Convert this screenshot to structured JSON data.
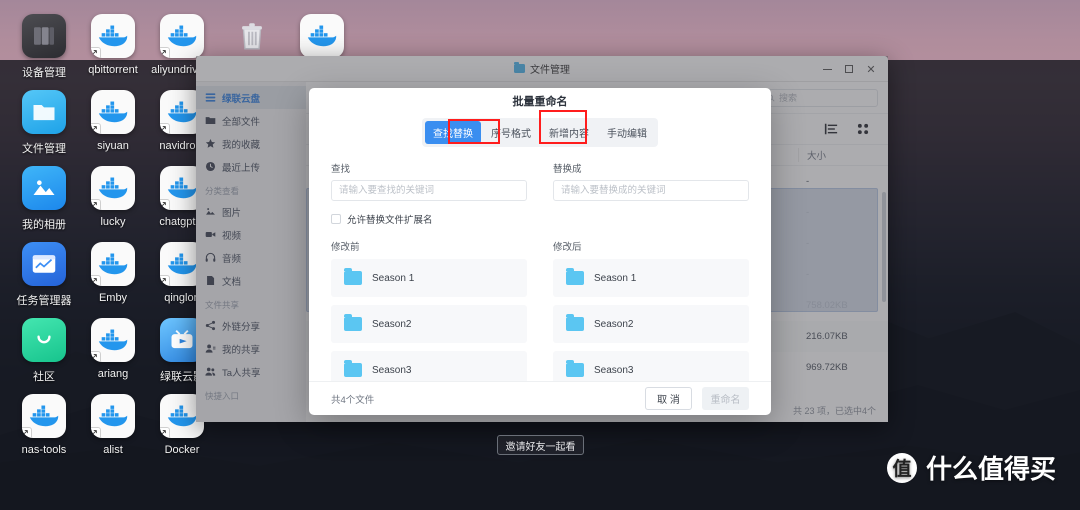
{
  "desktop": {
    "icons": [
      {
        "label": "设备管理",
        "icon": "device-manager-icon",
        "type": "device"
      },
      {
        "label": "qbittorrent",
        "icon": "docker-icon",
        "type": "docker"
      },
      {
        "label": "aliyundrive-s",
        "icon": "docker-icon",
        "type": "docker"
      },
      {
        "label": "文件管理",
        "icon": "file-manager-icon",
        "type": "files"
      },
      {
        "label": "siyuan",
        "icon": "docker-icon",
        "type": "docker"
      },
      {
        "label": "navidrom",
        "icon": "docker-icon",
        "type": "docker"
      },
      {
        "label": "我的相册",
        "icon": "photo-album-icon",
        "type": "album"
      },
      {
        "label": "lucky",
        "icon": "docker-icon",
        "type": "docker"
      },
      {
        "label": "chatgpt-v",
        "icon": "docker-icon",
        "type": "docker"
      },
      {
        "label": "任务管理器",
        "icon": "task-manager-icon",
        "type": "task"
      },
      {
        "label": "Emby",
        "icon": "docker-icon",
        "type": "docker"
      },
      {
        "label": "qinglon",
        "icon": "docker-icon",
        "type": "docker"
      },
      {
        "label": "社区",
        "icon": "community-icon",
        "type": "bbs"
      },
      {
        "label": "ariang",
        "icon": "docker-icon",
        "type": "docker"
      },
      {
        "label": "绿联云影",
        "icon": "tv-icon",
        "type": "tv"
      },
      {
        "label": "nas-tools",
        "icon": "docker-icon",
        "type": "docker"
      },
      {
        "label": "alist",
        "icon": "docker-icon",
        "type": "docker"
      },
      {
        "label": "Docker",
        "icon": "docker-icon",
        "type": "docker"
      }
    ],
    "trash_icon": "trash-icon",
    "top_docker_icon": "docker-icon",
    "invite_button": "邀请好友一起看",
    "watermark": {
      "mark": "值",
      "text": "什么值得买"
    }
  },
  "window": {
    "title": "文件管理",
    "title_icon": "blue-folder-icon",
    "controls": {
      "minimize": "–",
      "maximize": "□",
      "close": "✕"
    }
  },
  "sidebar": {
    "items": [
      {
        "label": "绿联云盘",
        "icon": "cloud-drive-icon",
        "active": true
      },
      {
        "label": "全部文件",
        "icon": "all-files-icon",
        "active": false
      },
      {
        "label": "我的收藏",
        "icon": "star-icon",
        "active": false
      },
      {
        "label": "最近上传",
        "icon": "clock-icon",
        "active": false
      }
    ],
    "section_category": "分类查看",
    "category_items": [
      {
        "label": "图片",
        "icon": "image-icon"
      },
      {
        "label": "视频",
        "icon": "video-icon"
      },
      {
        "label": "音频",
        "icon": "headphone-icon"
      },
      {
        "label": "文档",
        "icon": "document-icon"
      }
    ],
    "section_share": "文件共享",
    "share_items": [
      {
        "label": "外链分享",
        "icon": "share-icon"
      },
      {
        "label": "我的共享",
        "icon": "my-share-icon"
      },
      {
        "label": "Ta人共享",
        "icon": "others-share-icon"
      }
    ],
    "section_quick": "快捷入口"
  },
  "main": {
    "search_placeholder": "搜索",
    "search_icon": "search-icon",
    "view_list_icon": "list-view-icon",
    "view_grid_icon": "grid-view-icon",
    "size_column": "大小",
    "rows": [
      {
        "size": "-"
      },
      {
        "size": "-"
      },
      {
        "size": "-"
      },
      {
        "size": "-"
      },
      {
        "size": "758.02KB"
      },
      {
        "size": "216.07KB"
      },
      {
        "size": "969.72KB"
      }
    ],
    "status": "共 23 项，已选中4个"
  },
  "dialog": {
    "title": "批量重命名",
    "tabs": [
      {
        "label": "查找替换",
        "active": true,
        "annotated": true
      },
      {
        "label": "序号格式",
        "active": false,
        "annotated": false
      },
      {
        "label": "新增内容",
        "active": false,
        "annotated": true
      },
      {
        "label": "手动编辑",
        "active": false,
        "annotated": false
      }
    ],
    "find": {
      "label": "查找",
      "value": "",
      "placeholder": "请输入要查找的关键词"
    },
    "replace": {
      "label": "替换成",
      "value": "",
      "placeholder": "请输入要替换成的关键词"
    },
    "checkbox": {
      "label": "允许替换文件扩展名",
      "checked": false
    },
    "before_label": "修改前",
    "after_label": "修改后",
    "before_items": [
      "Season 1",
      "Season2",
      "Season3"
    ],
    "after_items": [
      "Season 1",
      "Season2",
      "Season3"
    ],
    "file_count": "共4个文件",
    "cancel_button": "取 消",
    "confirm_button": "重命名",
    "accent_color": "#3a8ef0",
    "annotation_color": "#ff1d1d"
  }
}
